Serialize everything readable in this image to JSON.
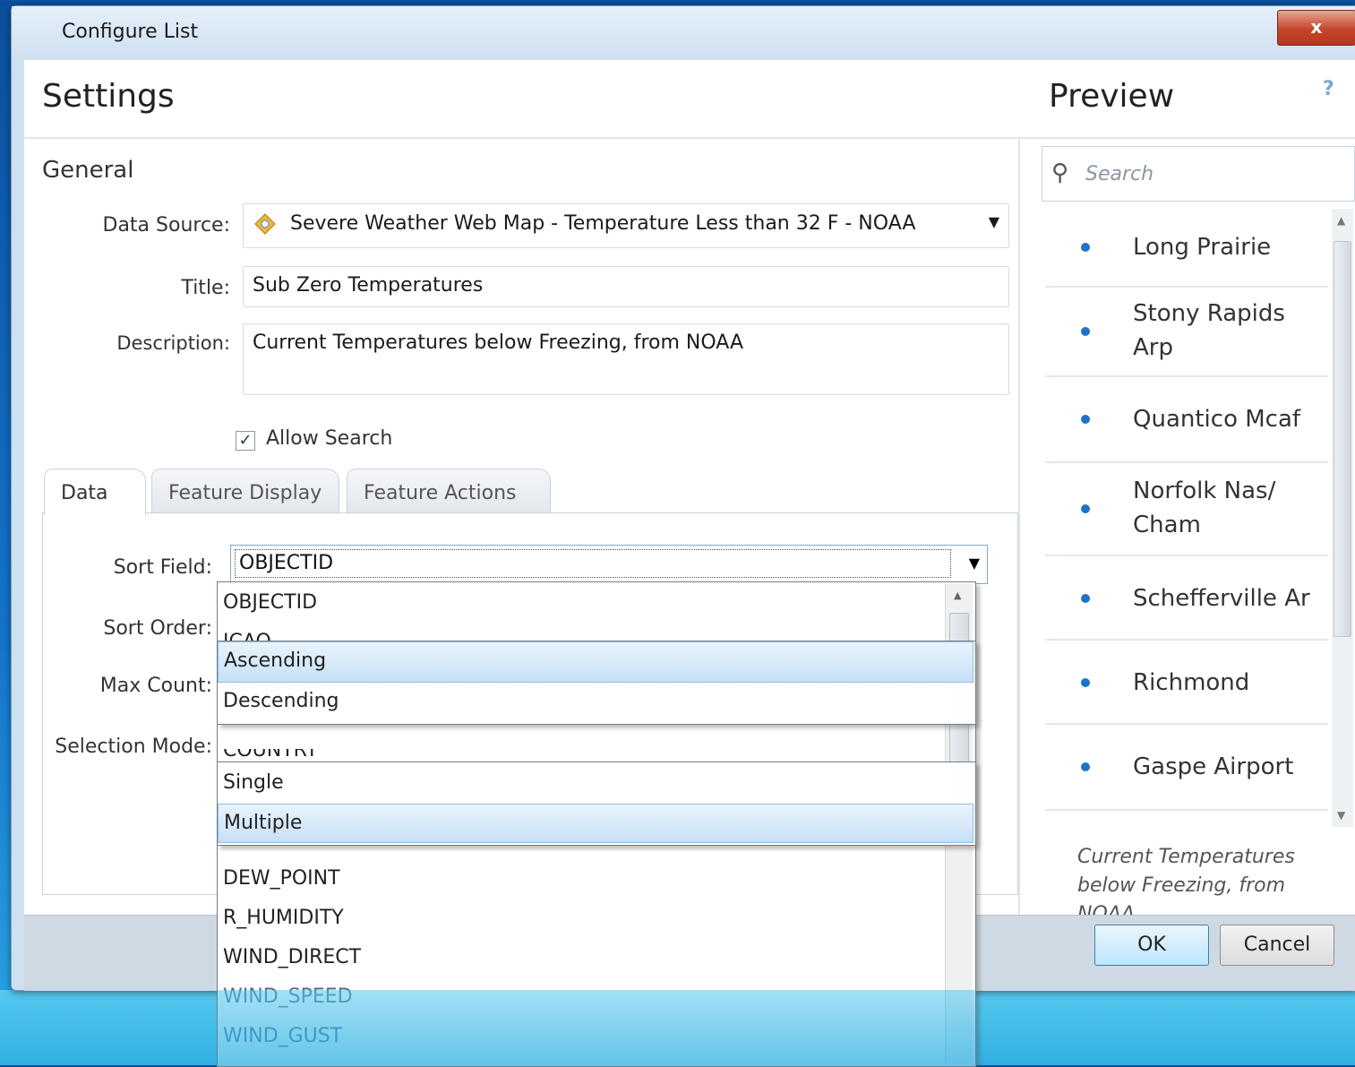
{
  "window": {
    "title": "Configure List",
    "close_glyph": "x"
  },
  "settings": {
    "heading": "Settings",
    "general_heading": "General",
    "data_source": {
      "label": "Data Source:",
      "value": "Severe Weather Web Map - Temperature Less than 32 F - NOAA",
      "icon": "map-layer-icon"
    },
    "title": {
      "label": "Title:",
      "value": "Sub Zero Temperatures"
    },
    "description": {
      "label": "Description:",
      "value": "Current Temperatures below Freezing, from NOAA"
    },
    "allow_search": {
      "label": "Allow Search",
      "checked": true,
      "check_glyph": "✓"
    }
  },
  "tabs": [
    {
      "label": "Data",
      "active": true
    },
    {
      "label": "Feature Display",
      "active": false
    },
    {
      "label": "Feature Actions",
      "active": false
    }
  ],
  "data_tab": {
    "sort_field": {
      "label": "Sort Field:",
      "value": "OBJECTID"
    },
    "sort_order": {
      "label": "Sort Order:"
    },
    "max_count": {
      "label": "Max Count:"
    },
    "selection_mode": {
      "label": "Selection Mode:"
    },
    "sort_field_options": [
      "OBJECTID",
      "ICAO",
      "COUNTRY",
      "DEW_POINT",
      "R_HUMIDITY",
      "WIND_DIRECT",
      "WIND_SPEED",
      "WIND_GUST"
    ],
    "sort_order_options": [
      "Ascending",
      "Descending"
    ],
    "sort_order_selected": "Ascending",
    "selection_mode_options": [
      "Single",
      "Multiple"
    ],
    "selection_mode_selected": "Multiple"
  },
  "preview": {
    "heading": "Preview",
    "help_glyph": "?",
    "search_placeholder": "Search",
    "items": [
      "Long Prairie",
      "Stony Rapids Arp",
      "Quantico Mcaf",
      "Norfolk Nas/ Cham",
      "Schefferville Ar",
      "Richmond",
      "Gaspe Airport"
    ],
    "description": "Current Temperatures below Freezing, from NOAA"
  },
  "buttons": {
    "ok": "OK",
    "cancel": "Cancel"
  },
  "colors": {
    "accent": "#1d73c9",
    "selection": "#c7e0f6",
    "close": "#c4452c"
  }
}
